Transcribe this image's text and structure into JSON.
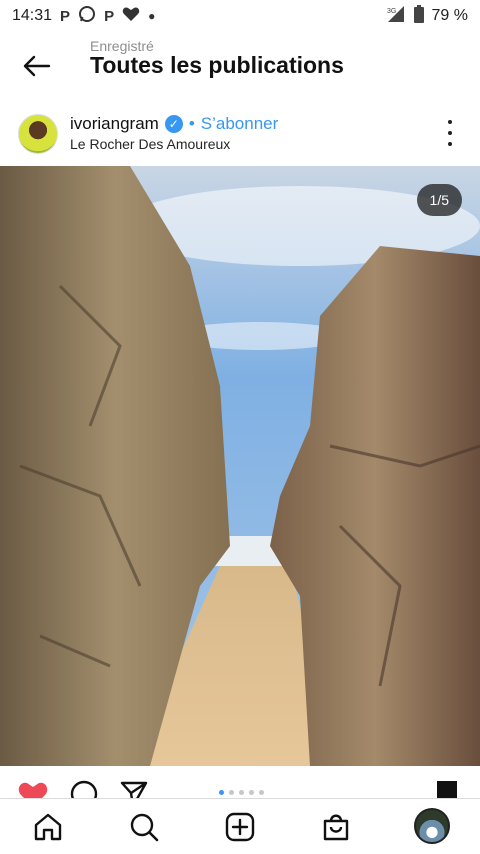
{
  "status_bar": {
    "time": "14:31",
    "notification_icons": [
      "p-icon",
      "whatsapp-icon",
      "p-icon",
      "heart-icon"
    ],
    "network": "3G",
    "battery": "79 %"
  },
  "header": {
    "subtitle": "Enregistré",
    "title": "Toutes les publications"
  },
  "post": {
    "username": "ivoriangram",
    "verified_symbol": "✓",
    "separator": "•",
    "follow_label": "S’abonner",
    "location": "Le Rocher Des Amoureux",
    "counter": "1/5",
    "carousel_count": 5,
    "carousel_active_index": 0
  },
  "actions": {
    "icons": [
      "heart-icon",
      "comment-icon",
      "share-icon",
      "bookmark-icon"
    ],
    "liked": true
  },
  "bottom_nav": {
    "items": [
      "home-icon",
      "search-icon",
      "create-icon",
      "shop-icon",
      "profile-avatar"
    ]
  },
  "colors": {
    "accent": "#3897f0",
    "like": "#ed4956",
    "text": "#262626",
    "muted": "#8e8e8e"
  }
}
